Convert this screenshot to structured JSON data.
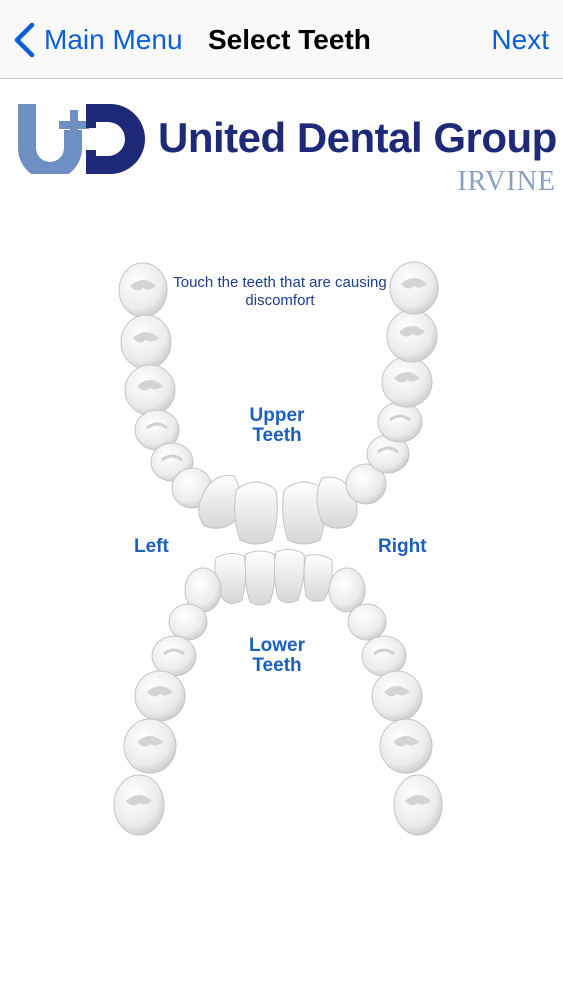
{
  "nav": {
    "back_label": "Main Menu",
    "title": "Select Teeth",
    "next_label": "Next"
  },
  "logo": {
    "name": "United Dental Group",
    "city": "IRVINE"
  },
  "chart": {
    "instructions": "Touch the teeth that are causing discomfort",
    "upper_label_line1": "Upper",
    "upper_label_line2": "Teeth",
    "lower_label_line1": "Lower",
    "lower_label_line2": "Teeth",
    "left_label": "Left",
    "right_label": "Right"
  },
  "colors": {
    "accent": "#0a5fd6",
    "label_blue": "#1c5fc0",
    "logo_navy": "#1e2a78",
    "logo_light": "#8aa0c3"
  }
}
